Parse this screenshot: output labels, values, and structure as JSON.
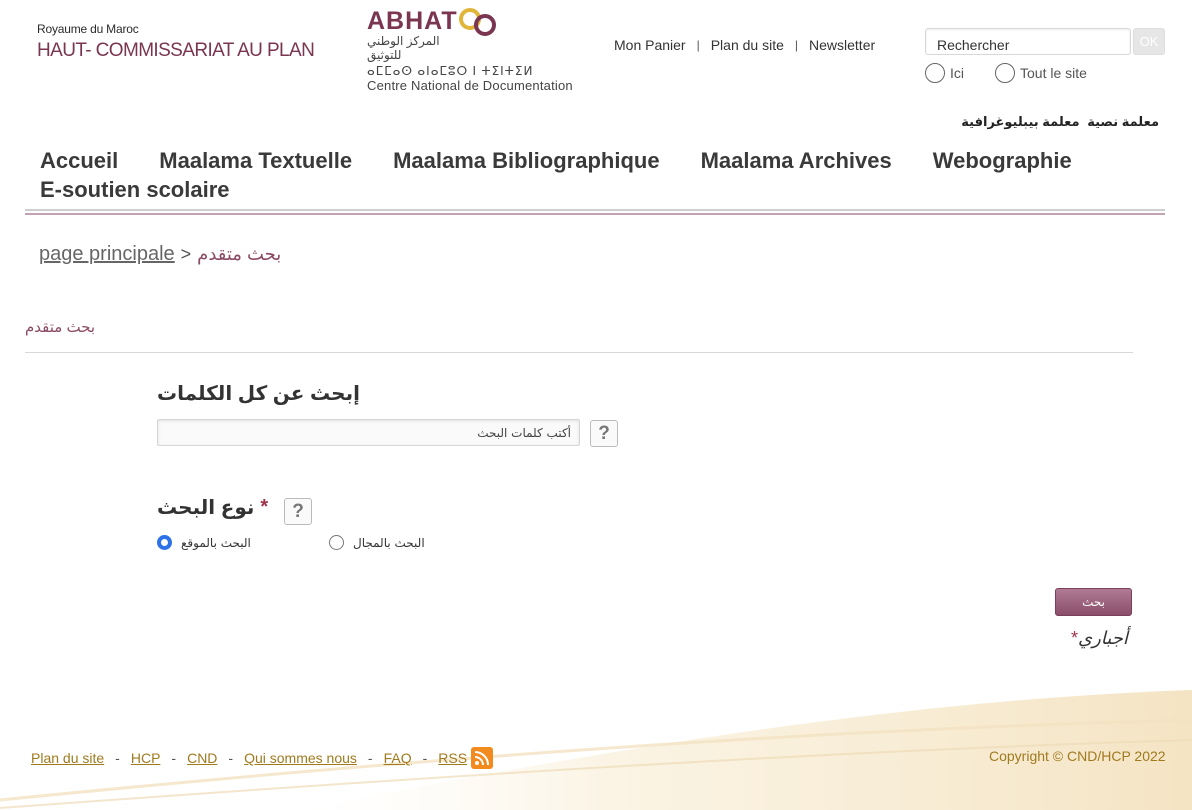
{
  "header": {
    "hcp_small": "Royaume du Maroc",
    "hcp_big": "HAUT- COMMISSARIAT AU PLAN",
    "abhat_title": "ABHAT",
    "abhat_arabic": "المركز الوطني للتوثيق",
    "abhat_tifinagh": "ⴰⵎⵎⴰⵙ ⴰⵏⴰⵎⵓⵔ ⵏ ⵜⵉⵏⵜⵉⵍ",
    "abhat_cnd": "Centre National de Documentation",
    "top_links": [
      "Mon Panier",
      "Plan du site",
      "Newsletter"
    ],
    "search_value": "Rechercher",
    "search_ok": "OK",
    "scope_ici": "Ici",
    "scope_tout": "Tout le site",
    "arabic_links": [
      "معلمة نصية",
      "معلمة بيبليوغرافية"
    ]
  },
  "nav": {
    "items": [
      "Accueil",
      "Maalama Textuelle",
      "Maalama Bibliographique",
      "Maalama Archives",
      "Webographie",
      "E-soutien scolaire"
    ]
  },
  "breadcrumb": {
    "home": "page principale",
    "arrow": ">",
    "current": "بحث متقدم"
  },
  "form": {
    "section_title": "بحث متقدم",
    "keywords_label": "إبحث عن كل الكلمات",
    "keywords_placeholder": "أكتب كلمات البحث",
    "help": "?",
    "type_label": "نوع البحث",
    "required_star": "*",
    "options": [
      {
        "label": "البحث بالموقع",
        "selected": true
      },
      {
        "label": "البحث بالمجال",
        "selected": false
      }
    ],
    "submit": "بحث",
    "required_note": "أجباري"
  },
  "footer": {
    "links": [
      "Plan du site",
      "HCP",
      "CND",
      "Qui sommes nous",
      "FAQ",
      "RSS"
    ],
    "copyright": "Copyright © CND/HCP 2022"
  },
  "colors": {
    "brand": "#7a3550",
    "accent_gold": "#e1b53a",
    "footer_gold": "#a07a1e",
    "radio_selected": "#2d72e6"
  }
}
